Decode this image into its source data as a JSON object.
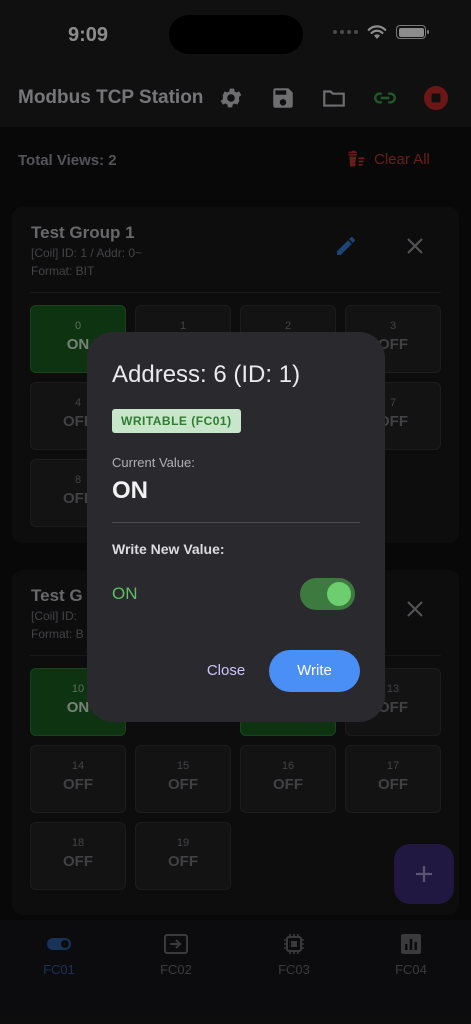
{
  "status_bar": {
    "time": "9:09"
  },
  "app_bar": {
    "title": "Modbus TCP Station"
  },
  "toolbar": {
    "total_views": "Total Views: 2",
    "clear_all": "Clear All"
  },
  "groups": [
    {
      "title": "Test Group 1",
      "meta": "[Coil] ID: 1 / Addr: 0~",
      "format": "Format: BIT",
      "cells": [
        {
          "num": "0",
          "state": "ON",
          "on": true
        },
        {
          "num": "1",
          "state": "",
          "on": false
        },
        {
          "num": "2",
          "state": "",
          "on": false
        },
        {
          "num": "3",
          "state": "OFF",
          "on": false
        },
        {
          "num": "4",
          "state": "OFF",
          "on": false
        },
        {
          "num": "7",
          "state": "OFF",
          "on": false
        },
        {
          "num": "8",
          "state": "OFF",
          "on": false
        }
      ]
    },
    {
      "title": "Test G",
      "meta": "[Coil] ID:",
      "format": "Format: B",
      "cells": [
        {
          "num": "10",
          "state": "ON",
          "on": true
        },
        {
          "num": "13",
          "state": "OFF",
          "on": false
        },
        {
          "num": "14",
          "state": "OFF",
          "on": false
        },
        {
          "num": "15",
          "state": "OFF",
          "on": false
        },
        {
          "num": "16",
          "state": "OFF",
          "on": false
        },
        {
          "num": "17",
          "state": "OFF",
          "on": false
        },
        {
          "num": "18",
          "state": "OFF",
          "on": false
        },
        {
          "num": "19",
          "state": "OFF",
          "on": false
        }
      ]
    }
  ],
  "dialog": {
    "title": "Address: 6 (ID: 1)",
    "badge": "WRITABLE (FC01)",
    "current_label": "Current Value:",
    "current_value": "ON",
    "write_label": "Write New Value:",
    "new_value_label": "ON",
    "toggle_on": true,
    "close_label": "Close",
    "write_btn_label": "Write"
  },
  "nav": [
    {
      "label": "FC01",
      "active": true
    },
    {
      "label": "FC02",
      "active": false
    },
    {
      "label": "FC03",
      "active": false
    },
    {
      "label": "FC04",
      "active": false
    }
  ],
  "colors": {
    "accent_blue": "#4a8ff5",
    "on_green": "#1b5e20",
    "danger_red": "#c0392b",
    "fab_purple": "#3c2d78"
  }
}
